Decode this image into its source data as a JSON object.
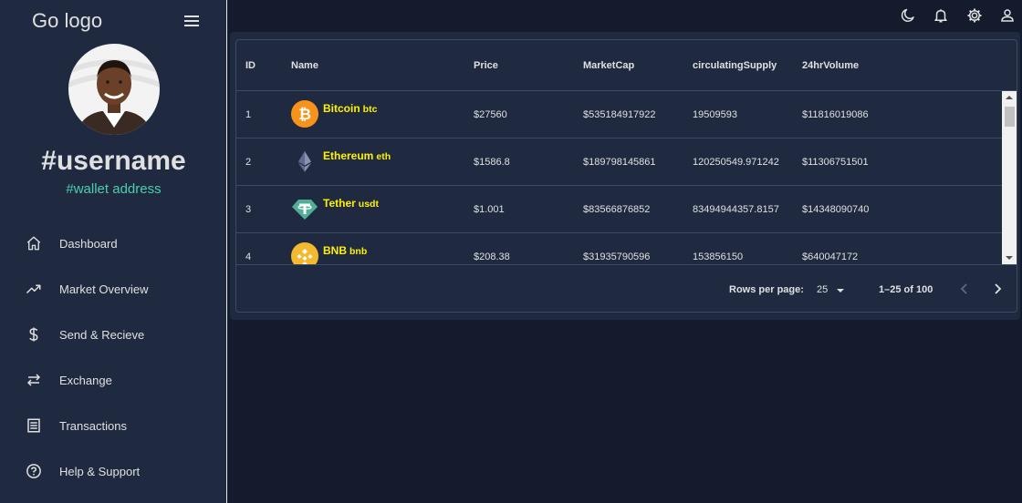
{
  "sidebar": {
    "logo": "Go logo",
    "username": "#username",
    "wallet": "#wallet address",
    "items": [
      {
        "label": "Dashboard",
        "icon": "home-icon"
      },
      {
        "label": "Market Overview",
        "icon": "trending-up-icon"
      },
      {
        "label": "Send & Recieve",
        "icon": "dollar-icon"
      },
      {
        "label": "Exchange",
        "icon": "swap-icon"
      },
      {
        "label": "Transactions",
        "icon": "receipt-icon"
      },
      {
        "label": "Help & Support",
        "icon": "help-icon"
      }
    ]
  },
  "topbar": {
    "icons": [
      "dark-mode-icon",
      "notifications-icon",
      "settings-icon",
      "user-icon"
    ]
  },
  "table": {
    "columns": [
      "ID",
      "Name",
      "Price",
      "MarketCap",
      "circulatingSupply",
      "24hrVolume"
    ],
    "rows": [
      {
        "id": "1",
        "name": "Bitcoin",
        "symbol": "btc",
        "price": "$27560",
        "marketcap": "$535184917922",
        "supply": "19509593",
        "volume": "$11816019086",
        "icon": "bitcoin-icon",
        "color": "#f7931a"
      },
      {
        "id": "2",
        "name": "Ethereum",
        "symbol": "eth",
        "price": "$1586.8",
        "marketcap": "$189798145861",
        "supply": "120250549.971242",
        "volume": "$11306751501",
        "icon": "ethereum-icon",
        "color": "#627eea"
      },
      {
        "id": "3",
        "name": "Tether",
        "symbol": "usdt",
        "price": "$1.001",
        "marketcap": "$83566876852",
        "supply": "83494944357.8157",
        "volume": "$14348090740",
        "icon": "tether-icon",
        "color": "#50af95"
      },
      {
        "id": "4",
        "name": "BNB",
        "symbol": "bnb",
        "price": "$208.38",
        "marketcap": "$31935790596",
        "supply": "153856150",
        "volume": "$640047172",
        "icon": "bnb-icon",
        "color": "#f3ba2f"
      }
    ]
  },
  "pagination": {
    "rows_per_page_label": "Rows per page:",
    "rows_per_page": "25",
    "range": "1–25 of 100"
  },
  "colors": {
    "sidebar": "#1f2a40",
    "background": "#141b2d",
    "accent_green": "#4cceac",
    "coin_name": "#fff200"
  }
}
